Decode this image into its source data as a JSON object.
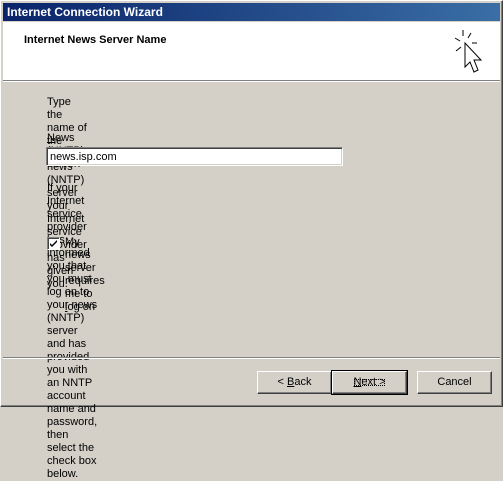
{
  "window": {
    "title": "Internet Connection Wizard"
  },
  "header": {
    "title": "Internet News Server Name",
    "icon": "wizard-cursor-icon"
  },
  "body": {
    "intro_text_line1": "Type the name of the Internet news (NNTP) server your Internet service provider has",
    "intro_text_line2": "given you.",
    "server_label_hotkey": "N",
    "server_label_rest": "ews (NNTP) server:",
    "server_value": "news.isp.com",
    "logon_text_line1": "If your Internet service provider has informed you that you must log on to your news",
    "logon_text_line2": "(NNTP) server and has provided you with an NNTP account name and password, then",
    "logon_text_line3": "select the check box below.",
    "checkbox_label_before": "My news server requires me to ",
    "checkbox_label_hotkey": "l",
    "checkbox_label_after": "og on",
    "checkbox_checked": true
  },
  "buttons": {
    "back_prefix": "< ",
    "back_hotkey": "B",
    "back_rest": "ack",
    "next_hotkey": "N",
    "next_rest": "ext >",
    "cancel_label": "Cancel"
  }
}
